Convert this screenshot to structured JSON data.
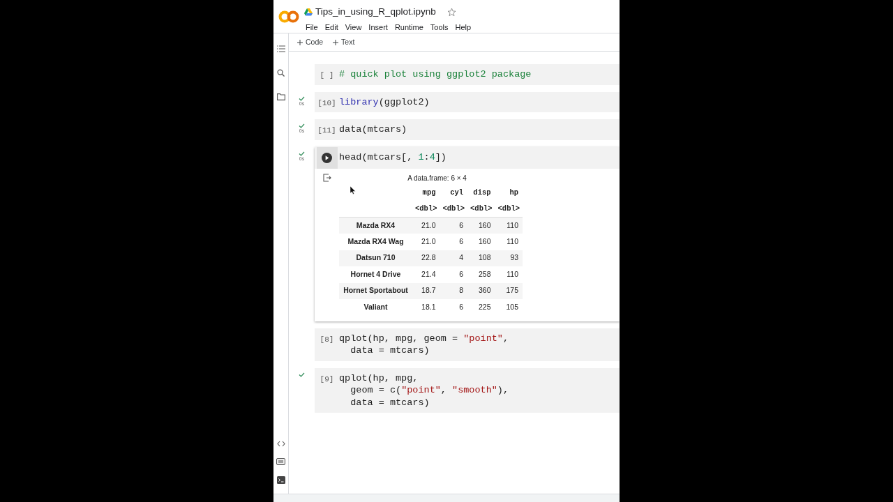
{
  "notebook": {
    "title": "Tips_in_using_R_qplot.ipynb",
    "starred": false
  },
  "menu": [
    "File",
    "Edit",
    "View",
    "Insert",
    "Runtime",
    "Tools",
    "Help"
  ],
  "toolbar": [
    "Code",
    "Text"
  ],
  "cells": [
    {
      "prompt": "[ ]",
      "ran": false,
      "focused": false,
      "lines": [
        [
          {
            "text": "# quick plot using ggplot2 package",
            "kind": "comment"
          }
        ]
      ]
    },
    {
      "prompt": "[10]",
      "ran": true,
      "time": "0s",
      "focused": false,
      "lines": [
        [
          {
            "text": "library",
            "kind": "keyword"
          },
          {
            "text": "(ggplot2)",
            "kind": "plain"
          }
        ]
      ]
    },
    {
      "prompt": "[11]",
      "ran": true,
      "time": "0s",
      "focused": false,
      "lines": [
        [
          {
            "text": "data(mtcars)",
            "kind": "plain"
          }
        ]
      ]
    },
    {
      "ran": true,
      "time": "0s",
      "focused": true,
      "lines": [
        [
          {
            "text": "head(mtcars[, ",
            "kind": "plain"
          },
          {
            "text": "1",
            "kind": "number"
          },
          {
            "text": ":",
            "kind": "plain"
          },
          {
            "text": "4",
            "kind": "number"
          },
          {
            "text": "])",
            "kind": "plain"
          }
        ]
      ],
      "output": {
        "caption": "A data.frame: 6 × 4",
        "columns": [
          {
            "name": "mpg",
            "type": "<dbl>"
          },
          {
            "name": "cyl",
            "type": "<dbl>"
          },
          {
            "name": "disp",
            "type": "<dbl>"
          },
          {
            "name": "hp",
            "type": "<dbl>"
          }
        ],
        "rows": [
          {
            "name": "Mazda RX4",
            "values": [
              "21.0",
              "6",
              "160",
              "110"
            ]
          },
          {
            "name": "Mazda RX4 Wag",
            "values": [
              "21.0",
              "6",
              "160",
              "110"
            ]
          },
          {
            "name": "Datsun 710",
            "values": [
              "22.8",
              "4",
              "108",
              "93"
            ]
          },
          {
            "name": "Hornet 4 Drive",
            "values": [
              "21.4",
              "6",
              "258",
              "110"
            ]
          },
          {
            "name": "Hornet Sportabout",
            "values": [
              "18.7",
              "8",
              "360",
              "175"
            ]
          },
          {
            "name": "Valiant",
            "values": [
              "18.1",
              "6",
              "225",
              "105"
            ]
          }
        ]
      }
    },
    {
      "prompt": "[8]",
      "ran": false,
      "focused": false,
      "lines": [
        [
          {
            "text": "qplot(hp, mpg, geom = ",
            "kind": "plain"
          },
          {
            "text": "\"point\"",
            "kind": "string"
          },
          {
            "text": ",",
            "kind": "plain"
          }
        ],
        [
          {
            "text": "  data = mtcars)",
            "kind": "plain"
          }
        ]
      ]
    },
    {
      "prompt": "[9]",
      "ran": true,
      "focused": false,
      "lines": [
        [
          {
            "text": "qplot(hp, mpg,",
            "kind": "plain"
          }
        ],
        [
          {
            "text": "  geom = c(",
            "kind": "plain"
          },
          {
            "text": "\"point\"",
            "kind": "string"
          },
          {
            "text": ", ",
            "kind": "plain"
          },
          {
            "text": "\"smooth\"",
            "kind": "string"
          },
          {
            "text": "),",
            "kind": "plain"
          }
        ],
        [
          {
            "text": "  data = mtcars)",
            "kind": "plain"
          }
        ]
      ]
    }
  ]
}
